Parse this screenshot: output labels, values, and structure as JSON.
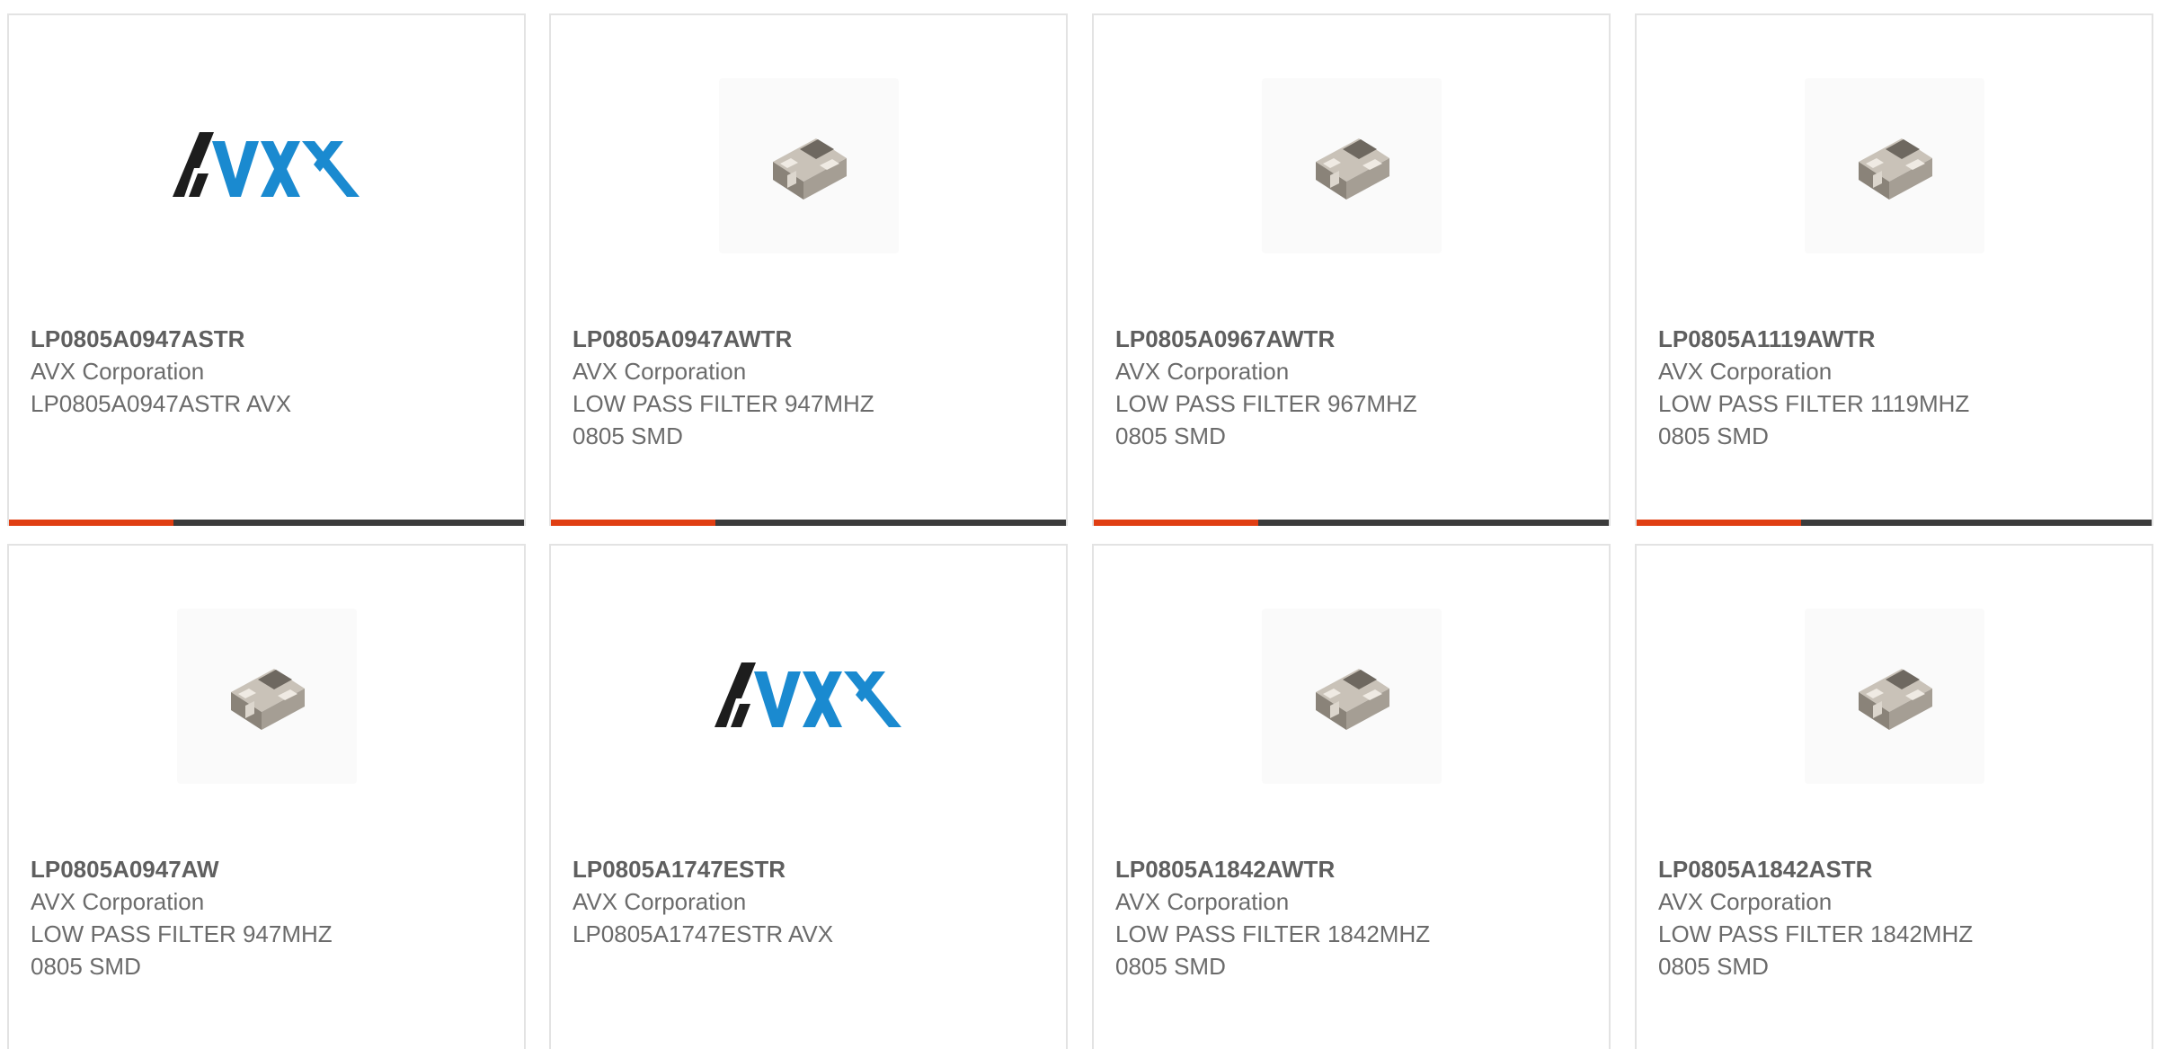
{
  "colors": {
    "accent": "#e03e12",
    "bar": "#3b3b3b",
    "avx_black": "#1d1d1d",
    "avx_blue": "#1a8ad0"
  },
  "products": [
    {
      "part": "LP0805A0947ASTR",
      "manufacturer": "AVX Corporation",
      "description": "LP0805A0947ASTR AVX",
      "image": "avx-logo"
    },
    {
      "part": "LP0805A0947AWTR",
      "manufacturer": "AVX Corporation",
      "description": "LOW PASS FILTER 947MHZ\n0805 SMD",
      "image": "chip-component"
    },
    {
      "part": "LP0805A0967AWTR",
      "manufacturer": "AVX Corporation",
      "description": "LOW PASS FILTER 967MHZ\n0805 SMD",
      "image": "chip-component"
    },
    {
      "part": "LP0805A1119AWTR",
      "manufacturer": "AVX Corporation",
      "description": "LOW PASS FILTER 1119MHZ\n0805 SMD",
      "image": "chip-component"
    },
    {
      "part": "LP0805A0947AW",
      "manufacturer": "AVX Corporation",
      "description": "LOW PASS FILTER 947MHZ\n0805 SMD",
      "image": "chip-component"
    },
    {
      "part": "LP0805A1747ESTR",
      "manufacturer": "AVX Corporation",
      "description": "LP0805A1747ESTR AVX",
      "image": "avx-logo"
    },
    {
      "part": "LP0805A1842AWTR",
      "manufacturer": "AVX Corporation",
      "description": "LOW PASS FILTER 1842MHZ\n0805 SMD",
      "image": "chip-component"
    },
    {
      "part": "LP0805A1842ASTR",
      "manufacturer": "AVX Corporation",
      "description": "LOW PASS FILTER 1842MHZ\n0805 SMD",
      "image": "chip-component"
    }
  ]
}
